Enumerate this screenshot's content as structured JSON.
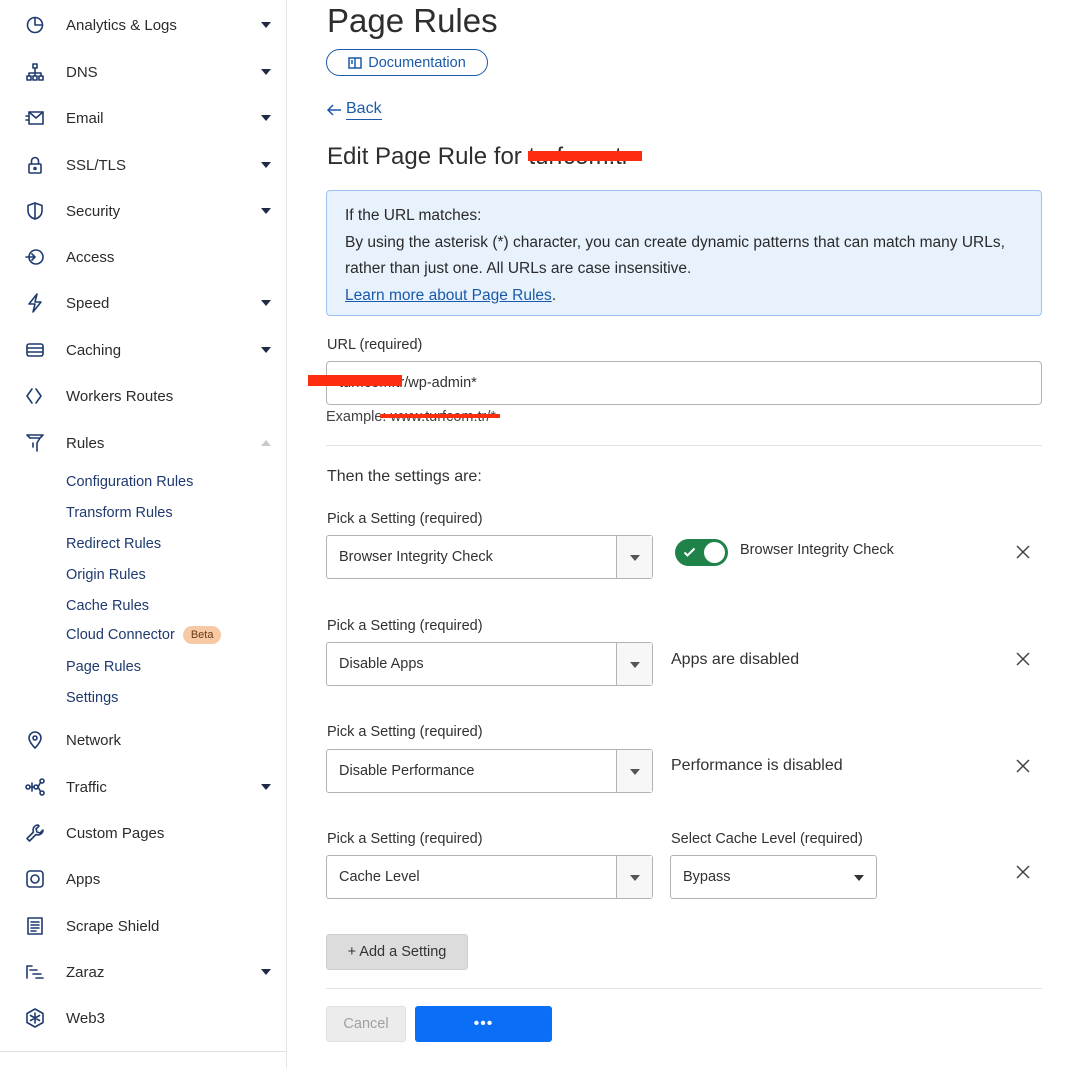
{
  "sidebar": {
    "items": [
      {
        "label": "Analytics & Logs",
        "icon": "analytics-icon",
        "caret": true
      },
      {
        "label": "DNS",
        "icon": "dns-icon",
        "caret": true
      },
      {
        "label": "Email",
        "icon": "email-icon",
        "caret": true
      },
      {
        "label": "SSL/TLS",
        "icon": "lock-icon",
        "caret": true
      },
      {
        "label": "Security",
        "icon": "shield-icon",
        "caret": true
      },
      {
        "label": "Access",
        "icon": "access-icon",
        "caret": false
      },
      {
        "label": "Speed",
        "icon": "lightning-icon",
        "caret": true
      },
      {
        "label": "Caching",
        "icon": "caching-icon",
        "caret": true
      },
      {
        "label": "Workers Routes",
        "icon": "workers-icon",
        "caret": false
      },
      {
        "label": "Rules",
        "icon": "rules-icon",
        "caret": "up"
      },
      {
        "label": "Network",
        "icon": "location-pin-icon",
        "caret": false
      },
      {
        "label": "Traffic",
        "icon": "traffic-icon",
        "caret": true
      },
      {
        "label": "Custom Pages",
        "icon": "wrench-icon",
        "caret": false
      },
      {
        "label": "Apps",
        "icon": "apps-icon",
        "caret": false
      },
      {
        "label": "Scrape Shield",
        "icon": "document-icon",
        "caret": false
      },
      {
        "label": "Zaraz",
        "icon": "zaraz-icon",
        "caret": true
      },
      {
        "label": "Web3",
        "icon": "web3-icon",
        "caret": false
      }
    ],
    "rules_sub": [
      {
        "label": "Configuration Rules"
      },
      {
        "label": "Transform Rules"
      },
      {
        "label": "Redirect Rules"
      },
      {
        "label": "Origin Rules"
      },
      {
        "label": "Cache Rules"
      },
      {
        "label": "Cloud Connector",
        "badge": "Beta"
      },
      {
        "label": "Page Rules"
      },
      {
        "label": "Settings"
      }
    ]
  },
  "main": {
    "title": "Page Rules",
    "doc_button": "Documentation",
    "back": "Back",
    "edit_title": "Edit Page Rule for turfcom.tr",
    "info": {
      "line1": "If the URL matches:",
      "line2": "By using the asterisk (*) character, you can create dynamic patterns that can match many URLs, rather than just one. All URLs are case insensitive.",
      "link": "Learn more about Page Rules",
      "link_suffix": "."
    },
    "url_label": "URL (required)",
    "url_value": "turf.com.tr/wp-admin*",
    "example": "Example: www.turfcom.tr/*",
    "then_label": "Then the settings are:",
    "settings": [
      {
        "label": "Pick a Setting (required)",
        "value": "Browser Integrity Check",
        "desc": "Browser Integrity Check",
        "toggle": true
      },
      {
        "label": "Pick a Setting (required)",
        "value": "Disable Apps",
        "desc": "Apps are disabled"
      },
      {
        "label": "Pick a Setting (required)",
        "value": "Disable Performance",
        "desc": "Performance is disabled"
      },
      {
        "label": "Pick a Setting (required)",
        "value": "Cache Level",
        "sub_label": "Select Cache Level (required)",
        "sub_value": "Bypass"
      }
    ],
    "add_setting": "+ Add a Setting",
    "cancel": "Cancel",
    "save": "•••"
  },
  "colors": {
    "accent": "#0a6ef7",
    "link": "#1a5aa8",
    "toggle_on": "#1f8249",
    "info_bg": "#e8f2fd",
    "redaction": "#ff2d10"
  }
}
